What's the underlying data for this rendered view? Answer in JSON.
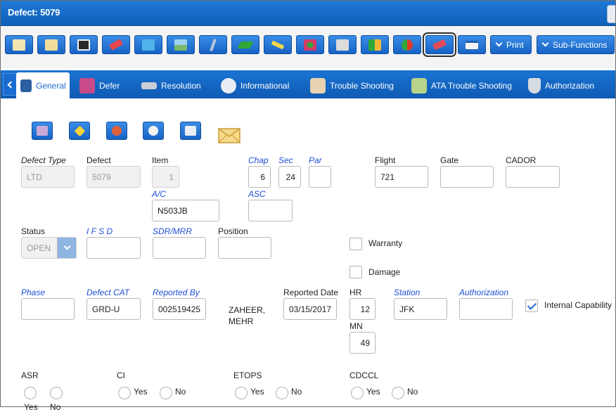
{
  "window": {
    "title": "Defect: 5079"
  },
  "toolbar": {
    "icons": [
      {
        "name": "new-record-icon",
        "color": "#f3e6b0"
      },
      {
        "name": "copy-record-icon",
        "color": "#f0dc9a"
      },
      {
        "name": "save-icon",
        "color": "#2a2a2a"
      },
      {
        "name": "eraser-icon",
        "color": "#e8464f"
      },
      {
        "name": "notebook-icon",
        "color": "#4fb2ea"
      },
      {
        "name": "picture-icon",
        "color": "#7ab86a"
      },
      {
        "name": "pencil-icon",
        "color": "#b9c6d8"
      },
      {
        "name": "checkmarks-icon",
        "color": "#2fa838"
      },
      {
        "name": "aircraft-icon",
        "color": "#f2d64a"
      },
      {
        "name": "tools-icon",
        "color": "#d23a6a"
      },
      {
        "name": "house-icon",
        "color": "#dcdcdc"
      },
      {
        "name": "transfer-icon",
        "color": "#f0b63a"
      },
      {
        "name": "status-light-icon",
        "color": "#e23a2a"
      },
      {
        "name": "eraser-red-icon",
        "color": "#e24a58"
      },
      {
        "name": "window-icon",
        "color": "#f4f4f4"
      }
    ],
    "print_label": "Print",
    "subfunctions_label": "Sub-Functions"
  },
  "tabs": [
    {
      "label": "General",
      "icon": "general-icon",
      "color": "#2b5fa0"
    },
    {
      "label": "Defer",
      "icon": "defer-icon",
      "color": "#c74a8a"
    },
    {
      "label": "Resolution",
      "icon": "wrench-icon",
      "color": "#c9ced6"
    },
    {
      "label": "Informational",
      "icon": "info-icon",
      "color": "#e9eef5"
    },
    {
      "label": "Trouble Shooting",
      "icon": "troubleshoot-icon",
      "color": "#e7d3b0"
    },
    {
      "label": "ATA Trouble Shooting",
      "icon": "ata-troubleshoot-icon",
      "color": "#b7d48a"
    },
    {
      "label": "Authorization",
      "icon": "shield-icon",
      "color": "#d7dbe2"
    }
  ],
  "subicons": [
    {
      "name": "defer-sub-icon",
      "color": "#c9a8d8"
    },
    {
      "name": "diamond-sub-icon",
      "color": "#f4d23a"
    },
    {
      "name": "gear-sub-icon",
      "color": "#e0603a"
    },
    {
      "name": "gauge-sub-icon",
      "color": "#f2f2f2"
    },
    {
      "name": "chart-sub-icon",
      "color": "#e9eef5"
    },
    {
      "name": "envelope-icon",
      "color": "#f6d98a"
    }
  ],
  "form": {
    "defect_type": {
      "label": "Defect Type",
      "value": "LTD"
    },
    "defect": {
      "label": "Defect",
      "value": "5079"
    },
    "item": {
      "label": "Item",
      "value": "1"
    },
    "chap": {
      "label": "Chap",
      "value": "6"
    },
    "sec": {
      "label": "Sec",
      "value": "24"
    },
    "par": {
      "label": "Par",
      "value": ""
    },
    "flight": {
      "label": "Flight",
      "value": "721"
    },
    "gate": {
      "label": "Gate",
      "value": ""
    },
    "cador": {
      "label": "CADOR",
      "value": ""
    },
    "ac": {
      "label": "A/C",
      "value": "N503JB"
    },
    "asc": {
      "label": "ASC",
      "value": ""
    },
    "status": {
      "label": "Status",
      "value": "OPEN"
    },
    "ifsd": {
      "label": "I F S D",
      "value": ""
    },
    "sdr_mrr": {
      "label": "SDR/MRR",
      "value": ""
    },
    "position": {
      "label": "Position",
      "value": ""
    },
    "warranty": {
      "label": "Warranty",
      "checked": false
    },
    "damage": {
      "label": "Damage",
      "checked": false
    },
    "phase": {
      "label": "Phase",
      "value": ""
    },
    "defect_cat": {
      "label": "Defect CAT",
      "value": "GRD-U"
    },
    "reported_by": {
      "label": "Reported By",
      "value": "002519425"
    },
    "reporter_name": {
      "line1": "ZAHEER,",
      "line2": "MEHR"
    },
    "reported_date": {
      "label": "Reported Date",
      "value": "03/15/2017"
    },
    "hr": {
      "label": "HR",
      "value": "12"
    },
    "mn": {
      "label": "MN",
      "value": "49"
    },
    "station": {
      "label": "Station",
      "value": "JFK"
    },
    "authorization": {
      "label": "Authorization",
      "value": ""
    },
    "internal_capability": {
      "label": "Internal Capability",
      "checked": true
    },
    "asr": {
      "label": "ASR",
      "yes": "Yes",
      "no": "No"
    },
    "ci": {
      "label": "CI",
      "yes": "Yes",
      "no": "No"
    },
    "etops": {
      "label": "ETOPS",
      "yes": "Yes",
      "no": "No"
    },
    "cdccl": {
      "label": "CDCCL",
      "yes": "Yes",
      "no": "No"
    }
  }
}
